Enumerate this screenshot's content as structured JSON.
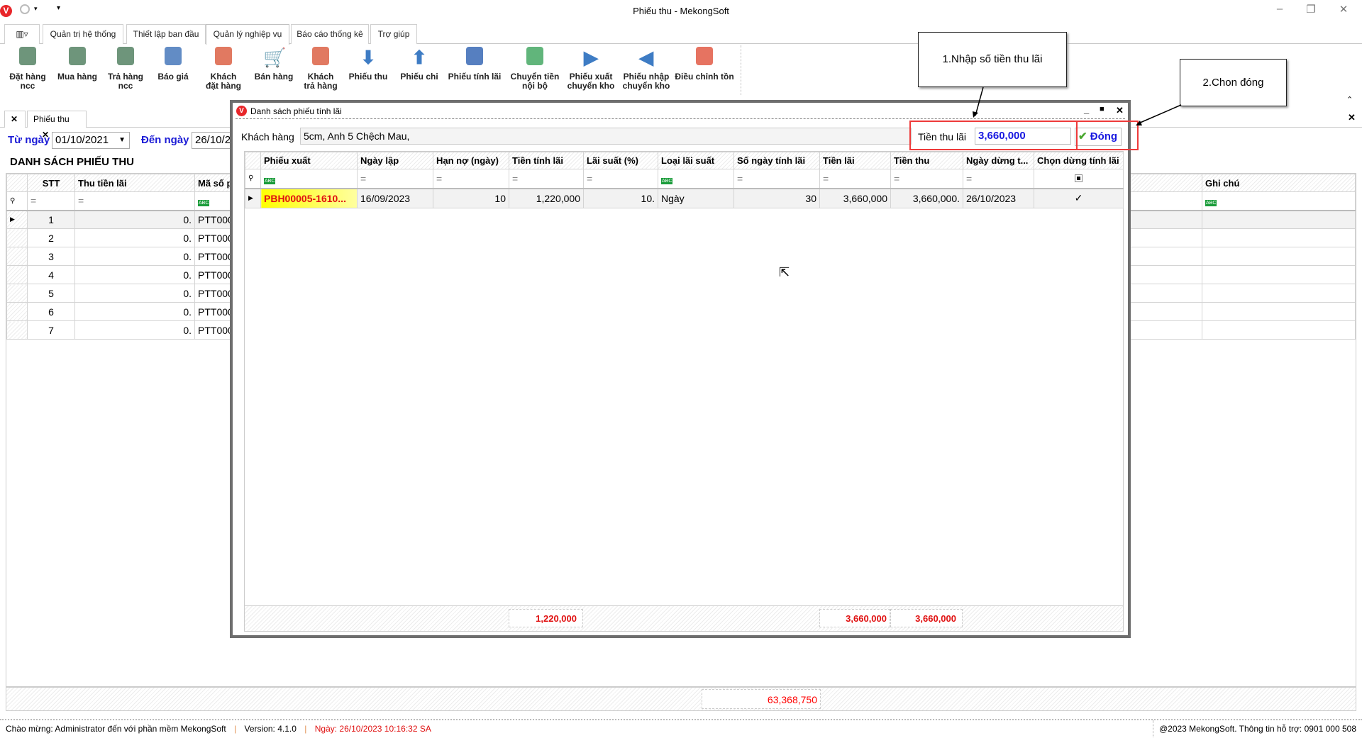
{
  "window": {
    "title": "Phiếu thu - MekongSoft",
    "logo": "V"
  },
  "ribbon_tabs": [
    "Quản trị hệ thống",
    "Thiết lập ban đầu",
    "Quản lý nghiệp vụ",
    "Báo cáo thống kê",
    "Trợ giúp"
  ],
  "ribbon_buttons": [
    {
      "l1": "Đặt hàng",
      "l2": "ncc",
      "icon": "contact-card-icon",
      "color": "#4a7a5a"
    },
    {
      "l1": "Mua hàng",
      "l2": "",
      "icon": "contact-add-icon",
      "color": "#4a7a5a"
    },
    {
      "l1": "Trả hàng",
      "l2": "ncc",
      "icon": "contact-edit-icon",
      "color": "#4a7a5a"
    },
    {
      "l1": "Báo giá",
      "l2": "",
      "icon": "quote-icon",
      "color": "#3b6fb6"
    },
    {
      "l1": "Khách",
      "l2": "đặt hàng",
      "icon": "customer-order-icon",
      "color": "#d9573a"
    },
    {
      "l1": "Bán hàng",
      "l2": "",
      "icon": "cart-icon",
      "color": "#d9573a"
    },
    {
      "l1": "Khách",
      "l2": "trả hàng",
      "icon": "customer-return-icon",
      "color": "#d9573a"
    },
    {
      "l1": "Phiếu thu",
      "l2": "",
      "icon": "arrow-down-icon",
      "color": "#3e7cc4"
    },
    {
      "l1": "Phiếu chi",
      "l2": "",
      "icon": "arrow-up-icon",
      "color": "#3e7cc4"
    },
    {
      "l1": "Phiếu tính lãi",
      "l2": "",
      "icon": "price-tag-icon",
      "color": "#2c5fb0"
    },
    {
      "l1": "Chuyển tiền",
      "l2": "nội bộ",
      "icon": "coins-icon",
      "color": "#3aa35a"
    },
    {
      "l1": "Phiếu xuất",
      "l2": "chuyển kho",
      "icon": "triangle-right-icon",
      "color": "#3e7cc4"
    },
    {
      "l1": "Phiếu nhập",
      "l2": "chuyển kho",
      "icon": "triangle-left-icon",
      "color": "#3e7cc4"
    },
    {
      "l1": "Điều chỉnh tồn",
      "l2": "",
      "icon": "eraser-icon",
      "color": "#e0503a"
    }
  ],
  "doc_tab": {
    "label": "Phiếu thu"
  },
  "filter": {
    "from_label": "Từ ngày",
    "from_value": "01/10/2021",
    "to_label": "Đến ngày",
    "to_value": "26/10/2"
  },
  "main": {
    "title": "DANH SÁCH PHIẾU THU",
    "columns": [
      "STT",
      "Thu tiền lãi",
      "Mã số p",
      "Ghi chú"
    ],
    "rows": [
      [
        "1",
        "0.",
        "PTT000"
      ],
      [
        "2",
        "0.",
        "PTT000"
      ],
      [
        "3",
        "0.",
        "PTT000"
      ],
      [
        "4",
        "0.",
        "PTT000"
      ],
      [
        "5",
        "0.",
        "PTT000"
      ],
      [
        "6",
        "0.",
        "PTT000"
      ],
      [
        "7",
        "0.",
        "PTT000"
      ]
    ],
    "total": "63,368,750"
  },
  "dialog": {
    "title": "Danh sách phiếu tính lãi",
    "customer_label": "Khách hàng",
    "customer_value": "5cm, Anh 5 Chệch Mau,",
    "interest_label": "Tiền thu lãi",
    "interest_value": "3,660,000",
    "close_label": "Đóng",
    "columns": [
      "Phiếu xuất",
      "Ngày lập",
      "Hạn nợ (ngày)",
      "Tiền tính lãi",
      "Lãi suất (%)",
      "Loại lãi suất",
      "Số ngày tính lãi",
      "Tiền lãi",
      "Tiền thu",
      "Ngày dừng t...",
      "Chọn dừng tính lãi"
    ],
    "row": [
      "PBH00005-1610...",
      "16/09/2023",
      "10",
      "1,220,000",
      "10.",
      "Ngày",
      "30",
      "3,660,000",
      "3,660,000.",
      "26/10/2023",
      "✓"
    ],
    "totals": {
      "tien_tinh_lai": "1,220,000",
      "tien_lai": "3,660,000",
      "tien_thu": "3,660,000"
    }
  },
  "callouts": {
    "one": "1.Nhập số tiền thu lãi",
    "two": "2.Chon đóng"
  },
  "status": {
    "welcome": "Chào mừng: Administrator đến với phần mềm MekongSoft",
    "version": "Version: 4.1.0",
    "date": "Ngày: 26/10/2023 10:16:32 SA",
    "copyright": "@2023 MekongSoft. Thông tin hỗ trợ: 0901 000 508"
  }
}
